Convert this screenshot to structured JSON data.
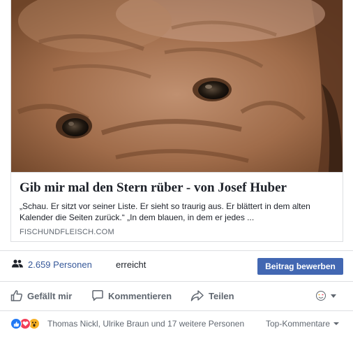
{
  "link_preview": {
    "title": "Gib mir mal den Stern rüber - von Josef Huber",
    "description": "„Schau. Er sitzt vor seiner Liste. Er sieht so traurig aus. Er blättert in dem alten Kalender die Seiten zurück.“ „In dem blauen, in dem er jedes ...",
    "domain": "FISCHUNDFLEISCH.COM"
  },
  "reach": {
    "count": "2.659 Personen",
    "suffix": "erreicht",
    "boost_label": "Beitrag bewerben"
  },
  "actions": {
    "like": "Gefällt mir",
    "comment": "Kommentieren",
    "share": "Teilen"
  },
  "reactions": {
    "types": [
      "like-icon",
      "love-icon",
      "wow-icon"
    ],
    "summary": "Thomas Nickl, Ulrike Braun und 17 weitere Personen",
    "comment_order": "Top-Kommentare"
  },
  "colors": {
    "link": "#365899",
    "button": "#4267b2",
    "muted": "#606770",
    "like": "#2078f4",
    "love": "#f33e58",
    "wow": "#f7b125"
  }
}
